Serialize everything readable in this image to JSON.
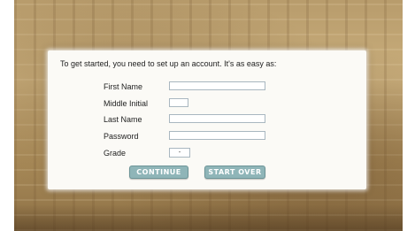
{
  "form": {
    "intro": "To get started, you need to set up an account. It's as easy as:",
    "fields": [
      {
        "label": "First Name",
        "value": ""
      },
      {
        "label": "Middle Initial",
        "value": ""
      },
      {
        "label": "Last Name",
        "value": ""
      },
      {
        "label": "Password",
        "value": ""
      },
      {
        "label": "Grade",
        "value": "-"
      }
    ],
    "buttons": {
      "continue": "CONTINUE",
      "start_over": "START OVER"
    }
  },
  "colors": {
    "panel": "#fbfaf6",
    "button": "#8fb5b8",
    "button_text": "#ffffff",
    "field_border": "#a9b7c0"
  }
}
